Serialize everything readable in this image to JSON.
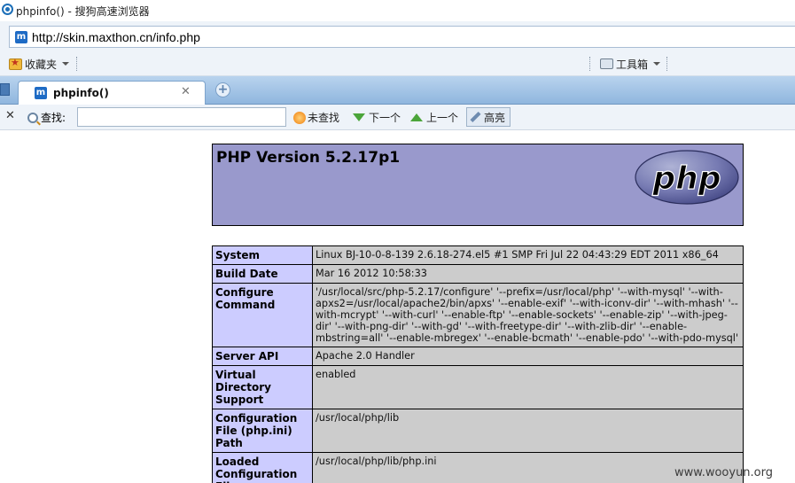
{
  "window": {
    "title": "phpinfo() - 搜狗高速浏览器"
  },
  "address_bar": {
    "url": "http://skin.maxthon.cn/info.php"
  },
  "favorites_bar": {
    "favorites_label": "收藏夹",
    "toolbox_label": "工具箱"
  },
  "tabs": [
    {
      "label": "phpinfo()",
      "active": true
    }
  ],
  "find_bar": {
    "label": "查找:",
    "value": "",
    "not_found_label": "未查找",
    "next_label": "下一个",
    "prev_label": "上一个",
    "highlight_label": "高亮"
  },
  "page": {
    "version_title": "PHP Version 5.2.17p1",
    "logo_text": "php",
    "rows": [
      {
        "key": "System",
        "value": "Linux BJ-10-0-8-139 2.6.18-274.el5 #1 SMP Fri Jul 22 04:43:29 EDT 2011 x86_64"
      },
      {
        "key": "Build Date",
        "value": "Mar 16 2012 10:58:33"
      },
      {
        "key": "Configure Command",
        "value": "'/usr/local/src/php-5.2.17/configure' '--prefix=/usr/local/php' '--with-mysql' '--with-apxs2=/usr/local/apache2/bin/apxs' '--enable-exif' '--with-iconv-dir' '--with-mhash' '--with-mcrypt' '--with-curl' '--enable-ftp' '--enable-sockets' '--enable-zip' '--with-jpeg-dir' '--with-png-dir' '--with-gd' '--with-freetype-dir' '--with-zlib-dir' '--enable-mbstring=all' '--enable-mbregex' '--enable-bcmath' '--enable-pdo' '--with-pdo-mysql'"
      },
      {
        "key": "Server API",
        "value": "Apache 2.0 Handler"
      },
      {
        "key": "Virtual Directory Support",
        "value": "enabled"
      },
      {
        "key": "Configuration File (php.ini) Path",
        "value": "/usr/local/php/lib"
      },
      {
        "key": "Loaded Configuration File",
        "value": "/usr/local/php/lib/php.ini"
      }
    ]
  },
  "watermark": "www.wooyun.org",
  "colors": {
    "php_header": "#9999cc",
    "key_cell": "#ccccff",
    "value_cell": "#cccccc",
    "tab_bar": "#8fb6de"
  }
}
